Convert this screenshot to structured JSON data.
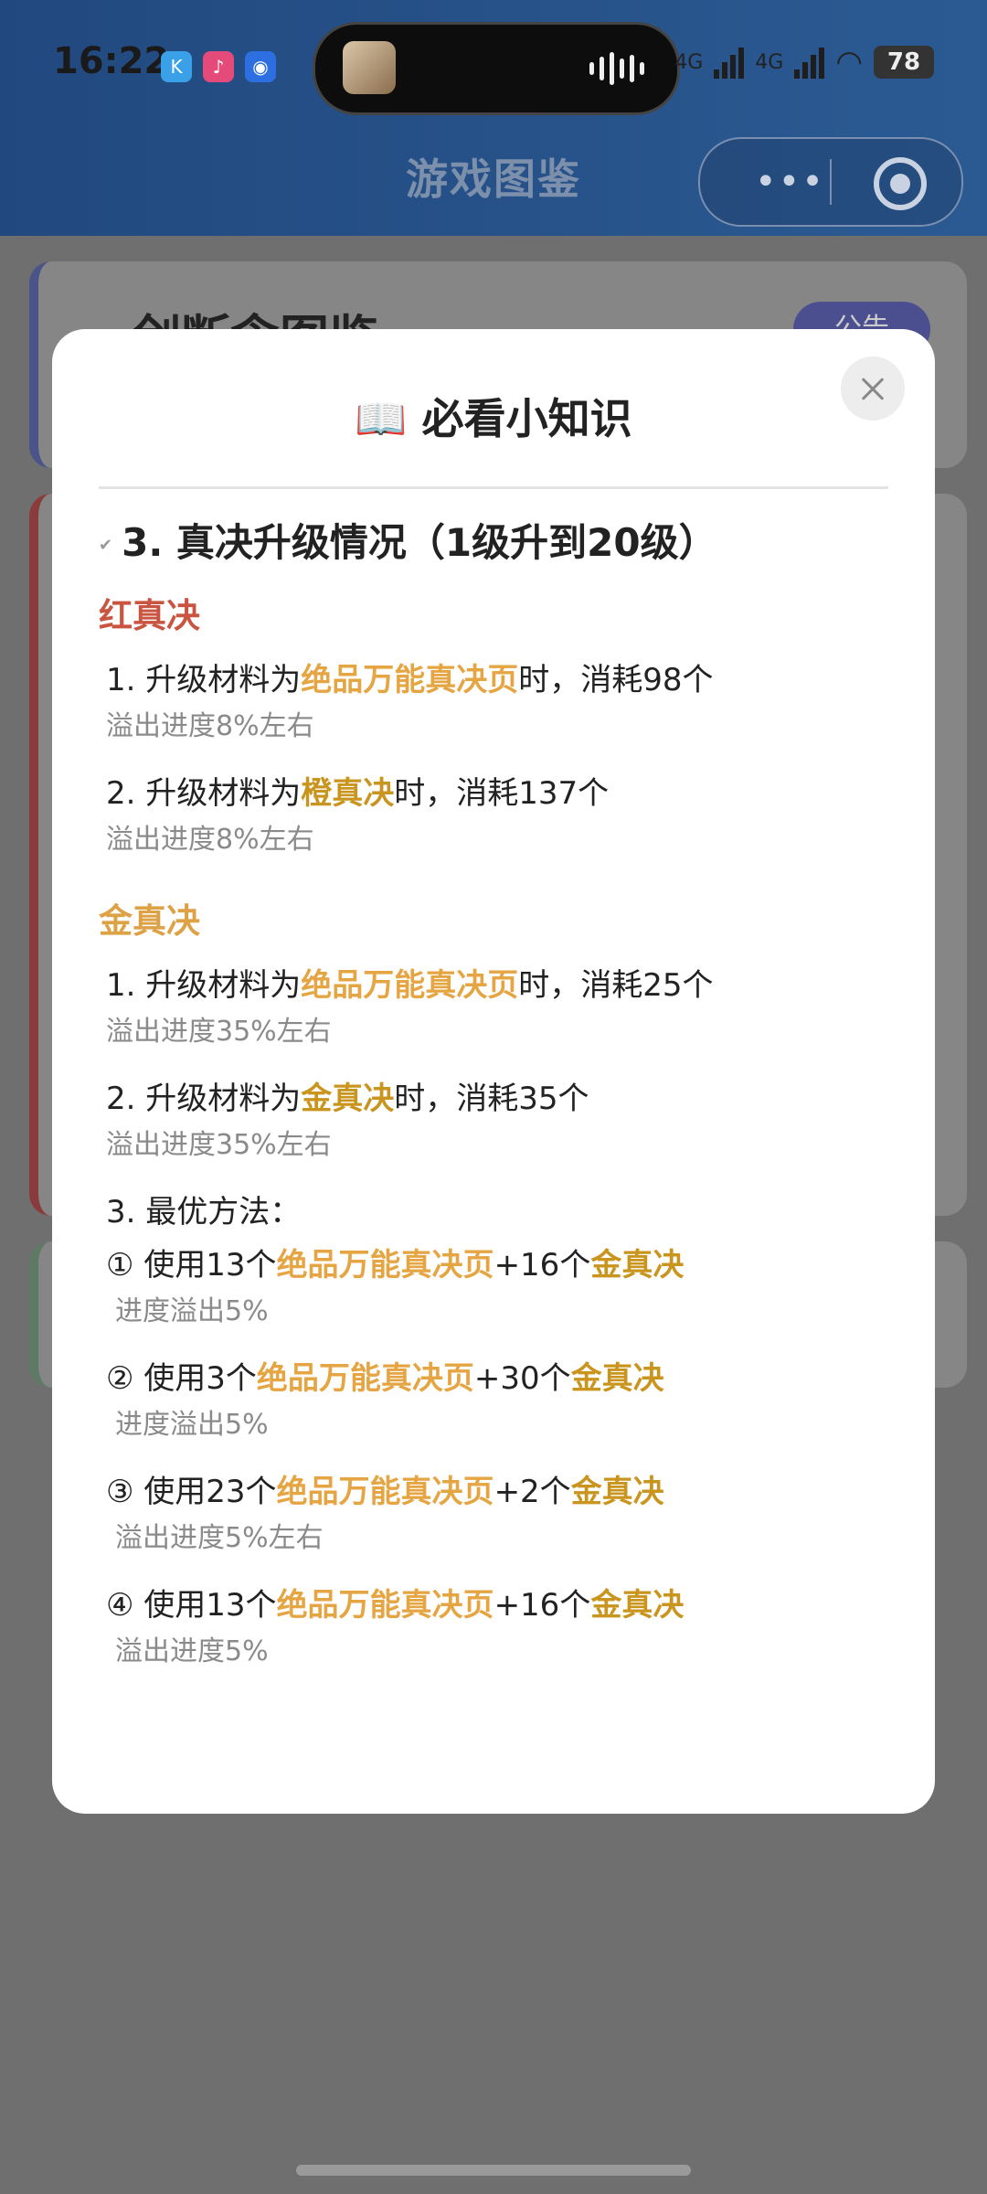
{
  "status": {
    "time": "16:22",
    "battery": "78",
    "network1": "4G",
    "network2": "4G",
    "app_badge_k": "K"
  },
  "header": {
    "title": "游戏图鉴"
  },
  "background_cards": [
    {
      "title": "一剑断念图鉴",
      "badge": "公告"
    }
  ],
  "modal": {
    "title": "📖 必看小知识",
    "section_heading": "3. 真决升级情况（1级升到20级）",
    "red": {
      "label": "红真决",
      "items": [
        {
          "prefix": "1. 升级材料为",
          "highlight": "绝品万能真决页",
          "suffix": "时，消耗98个",
          "note": "溢出进度8%左右"
        },
        {
          "prefix": "2. 升级材料为",
          "highlight": "橙真决",
          "suffix": "时，消耗137个",
          "note": "溢出进度8%左右"
        }
      ]
    },
    "gold": {
      "label": "金真决",
      "items": [
        {
          "prefix": "1. 升级材料为",
          "highlight": "绝品万能真决页",
          "suffix": "时，消耗25个",
          "note": "溢出进度35%左右"
        },
        {
          "prefix": "2. 升级材料为",
          "highlight": "金真决",
          "suffix": "时，消耗35个",
          "note": "溢出进度35%左右"
        }
      ],
      "best_label": "3. 最优方法：",
      "options": [
        {
          "a": "① 使用13个",
          "b": "绝品万能真决页",
          "c": "+16个",
          "d": "金真决",
          "note": "进度溢出5%"
        },
        {
          "a": "② 使用3个",
          "b": "绝品万能真决页",
          "c": "+30个",
          "d": "金真决",
          "note": "进度溢出5%"
        },
        {
          "a": "③ 使用23个",
          "b": "绝品万能真决页",
          "c": "+2个",
          "d": "金真决",
          "note": "溢出进度5%左右"
        },
        {
          "a": "④ 使用13个",
          "b": "绝品万能真决页",
          "c": "+16个",
          "d": "金真决",
          "note": "溢出进度5%"
        }
      ]
    }
  },
  "colors": {
    "header_bg": "#21497f",
    "red_label": "#c9543f",
    "gold_label": "#dda146",
    "highlight_orange": "#e6a543",
    "highlight_gold": "#c9951f"
  }
}
